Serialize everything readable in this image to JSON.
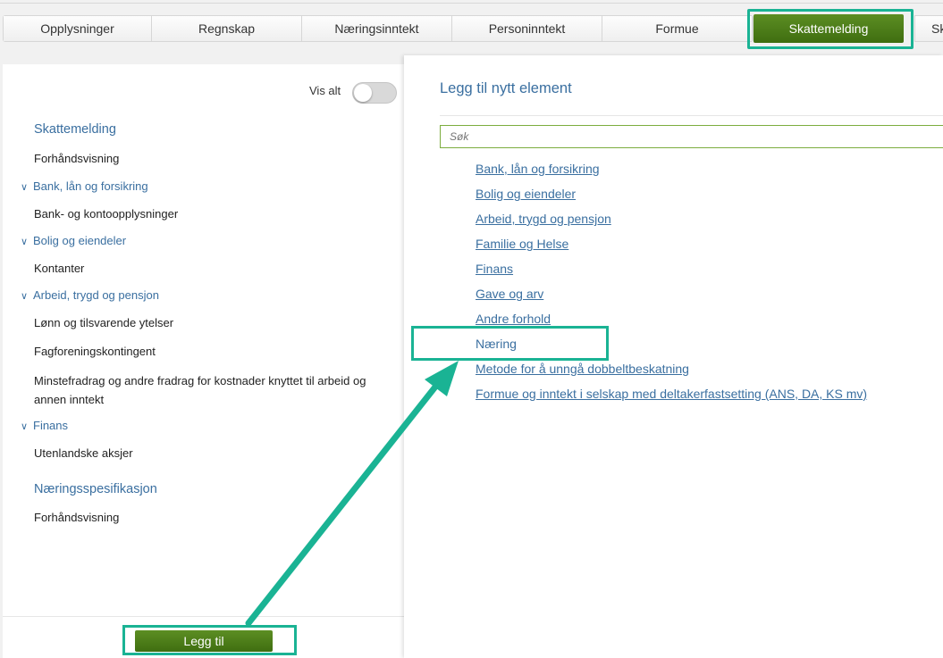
{
  "tabs": {
    "items": [
      {
        "label": "Opplysninger",
        "name": "tab-opplysninger"
      },
      {
        "label": "Regnskap",
        "name": "tab-regnskap"
      },
      {
        "label": "Næringsinntekt",
        "name": "tab-naeringsinntekt"
      },
      {
        "label": "Personinntekt",
        "name": "tab-personinntekt"
      },
      {
        "label": "Formue",
        "name": "tab-formue"
      }
    ],
    "active_label": "Skattemelding",
    "partial_label": "Sk"
  },
  "left": {
    "visalt_label": "Vis alt",
    "toggle_on": false,
    "tree": [
      {
        "kind": "section",
        "label": "Skattemelding"
      },
      {
        "kind": "item",
        "label": "Forhåndsvisning"
      },
      {
        "kind": "group",
        "label": "Bank, lån og forsikring"
      },
      {
        "kind": "item",
        "label": "Bank- og kontoopplysninger"
      },
      {
        "kind": "group",
        "label": "Bolig og eiendeler"
      },
      {
        "kind": "item",
        "label": "Kontanter"
      },
      {
        "kind": "group",
        "label": "Arbeid, trygd og pensjon"
      },
      {
        "kind": "item",
        "label": "Lønn og tilsvarende ytelser"
      },
      {
        "kind": "item",
        "label": "Fagforeningskontingent"
      },
      {
        "kind": "item",
        "label": "Minstefradrag og andre fradrag for kostnader knyttet til arbeid og annen inntekt"
      },
      {
        "kind": "group",
        "label": "Finans"
      },
      {
        "kind": "item",
        "label": "Utenlandske aksjer"
      },
      {
        "kind": "section",
        "label": "Næringsspesifikasjon"
      },
      {
        "kind": "item",
        "label": "Forhåndsvisning"
      }
    ],
    "add_button_label": "Legg til"
  },
  "right": {
    "title": "Legg til nytt element",
    "search_placeholder": "Søk",
    "links": [
      {
        "label": "Bank, lån og forsikring",
        "link": true
      },
      {
        "label": "Bolig og eiendeler",
        "link": true
      },
      {
        "label": "Arbeid, trygd og pensjon",
        "link": true
      },
      {
        "label": "Familie og Helse",
        "link": true
      },
      {
        "label": "Finans",
        "link": true
      },
      {
        "label": "Gave og arv",
        "link": true
      },
      {
        "label": "Andre forhold",
        "link": true
      },
      {
        "label": "Næring",
        "link": false
      },
      {
        "label": "Metode for å unngå dobbeltbeskatning",
        "link": true
      },
      {
        "label": "Formue og inntekt i selskap med deltakerfastsetting (ANS, DA, KS mv)",
        "link": true
      }
    ]
  },
  "colors": {
    "accent_green": "#4a7a18",
    "highlight_teal": "#1ab394",
    "link_blue": "#3a6fa0"
  }
}
